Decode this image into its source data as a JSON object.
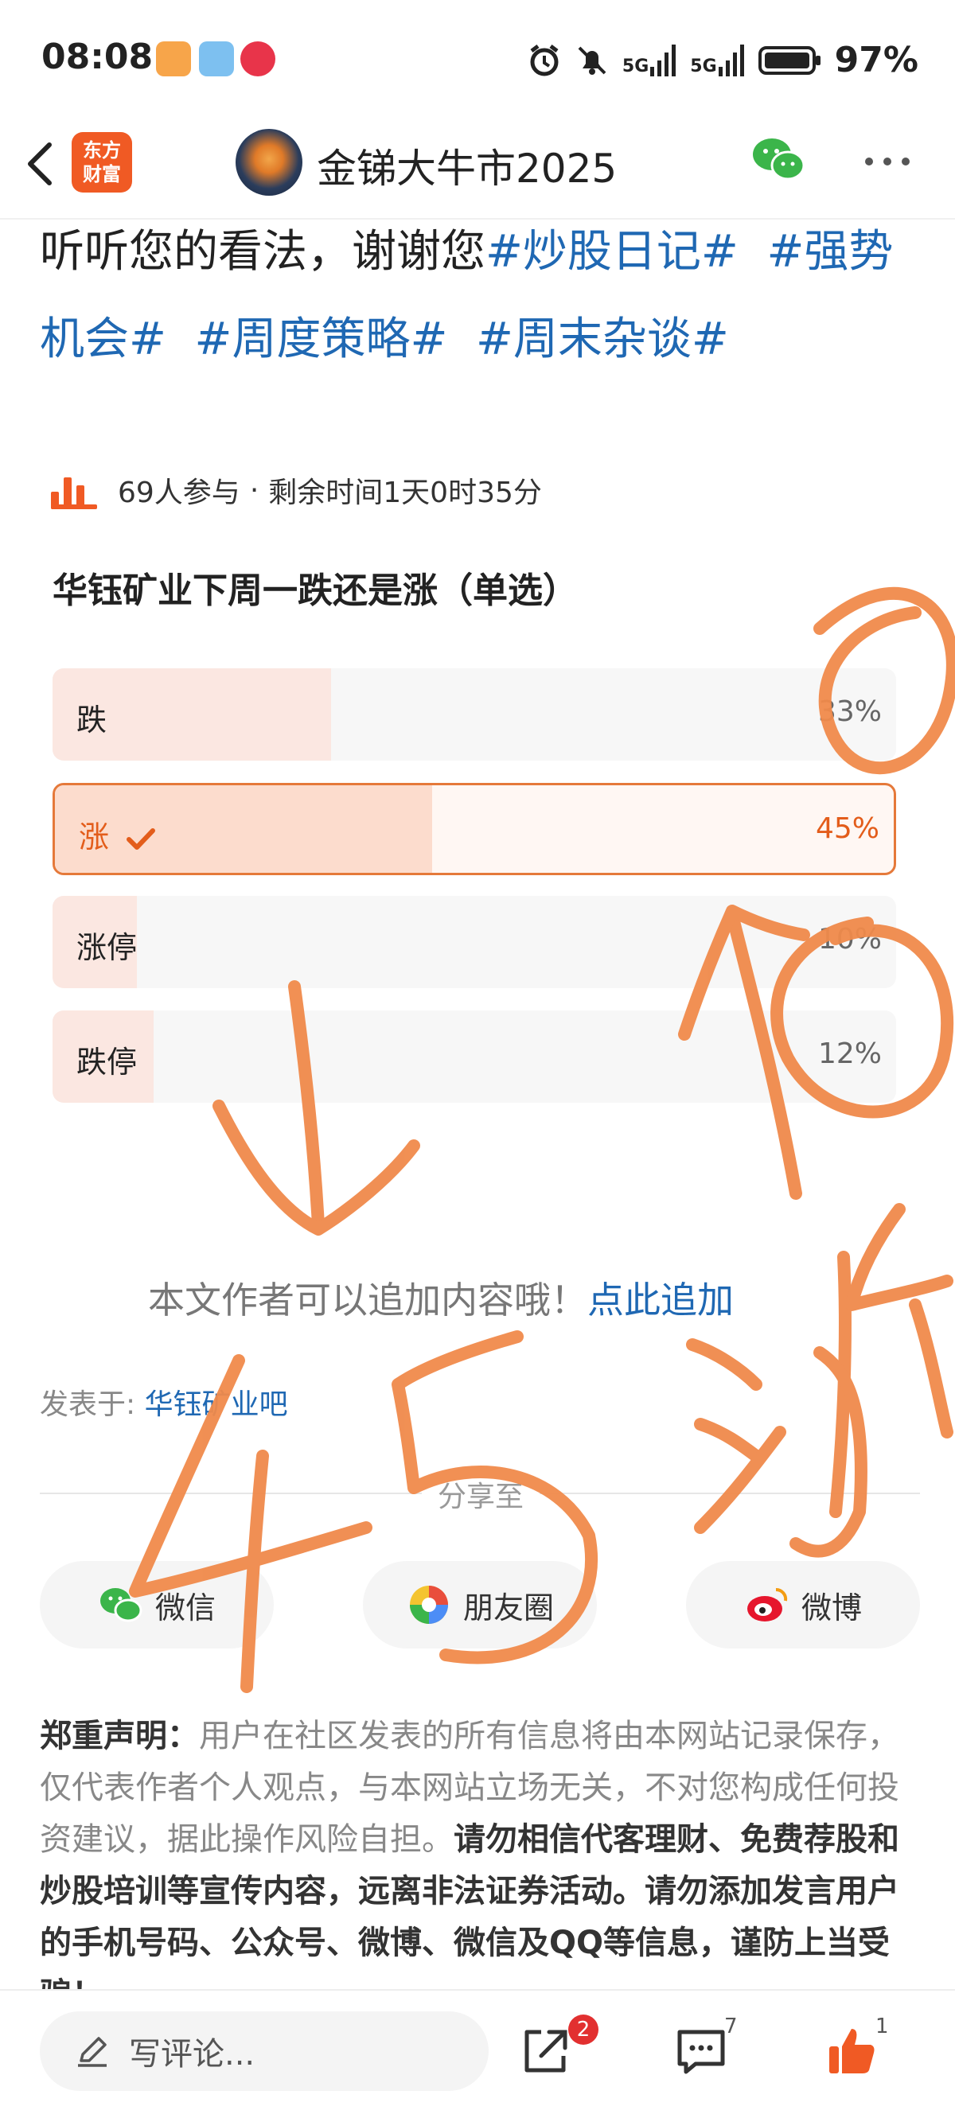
{
  "status_bar": {
    "time": "08:08",
    "signal1": "5G",
    "signal2": "5G",
    "battery": "97%"
  },
  "nav": {
    "brand_line1": "东方",
    "brand_line2": "财富",
    "title": "金锑大牛市2025"
  },
  "article": {
    "lead": "听听您的看法，谢谢您",
    "tags": [
      "#炒股日记#",
      "#强势机会#",
      "#周度策略#",
      "#周末杂谈#"
    ]
  },
  "poll": {
    "participants": "69人参与",
    "separator": "·",
    "remaining": "剩余时间1天0时35分",
    "question": "华钰矿业下周一跌还是涨（单选）",
    "options": [
      {
        "label": "跌",
        "percent_text": "33%",
        "fraction": 0.33,
        "selected": false
      },
      {
        "label": "涨",
        "percent_text": "45%",
        "fraction": 0.45,
        "selected": true
      },
      {
        "label": "涨停",
        "percent_text": "10%",
        "fraction": 0.1,
        "selected": false
      },
      {
        "label": "跌停",
        "percent_text": "12%",
        "fraction": 0.12,
        "selected": false
      }
    ]
  },
  "append": {
    "text": "本文作者可以追加内容哦！",
    "link": "点此追加"
  },
  "posted_in": {
    "label": "发表于:",
    "bar": "华钰矿业吧"
  },
  "share": {
    "label": "分享至",
    "buttons": [
      "微信",
      "朋友圈",
      "微博"
    ]
  },
  "disclaimer": {
    "title": "郑重声明：",
    "body1": "用户在社区发表的所有信息将由本网站记录保存，仅代表作者个人观点，与本网站立场无关，不对您构成任何投资建议，据此操作风险自担。",
    "body2": "请勿相信代客理财、免费荐股和炒股培训等宣传内容，远离非法证券活动。请勿添加发言用户的手机号码、公众号、微博、微信及QQ等信息，谨防上当受骗！"
  },
  "bottom_bar": {
    "comment_placeholder": "写评论...",
    "share_badge": "2",
    "comment_count": "7",
    "like_count": "1"
  },
  "handwriting": {
    "note": "45 涨"
  },
  "colors": {
    "accent": "#f05a24",
    "link": "#1f68b3",
    "selected_border": "#e5793a",
    "scribble": "#f08a4b"
  }
}
